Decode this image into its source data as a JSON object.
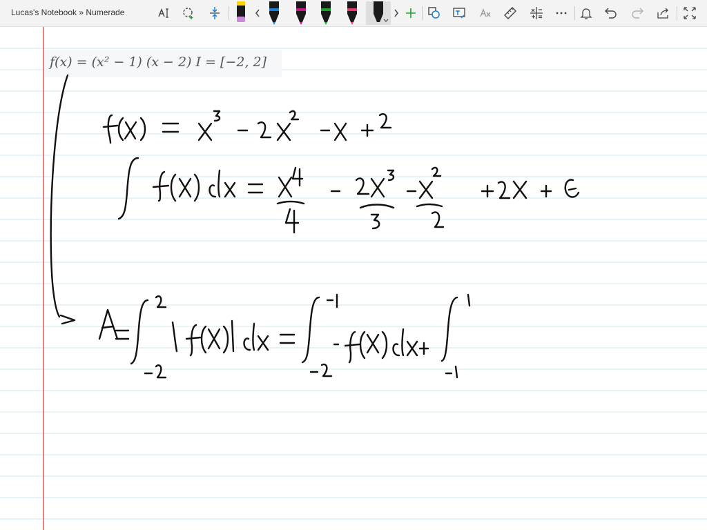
{
  "window": {
    "title": "Lucas's Notebook » Numerade"
  },
  "toolbar": {
    "icons": [
      "lasso-text-select-icon",
      "lasso-select-icon",
      "insert-space-icon",
      "eraser-icon",
      "chevron-left-icon",
      "pen-blue-icon",
      "pen-magenta-icon",
      "pen-green-icon",
      "pen-pink-icon",
      "pen-black-icon",
      "chevron-right-icon",
      "add-pen-icon",
      "ink-to-shape-icon",
      "ink-to-text-icon",
      "ink-to-math-icon",
      "ruler-icon",
      "math-icon",
      "more-icon",
      "notifications-icon",
      "undo-icon",
      "redo-icon",
      "share-icon",
      "fullscreen-icon"
    ],
    "pen_colors": {
      "blue": "#1e7fd8",
      "magenta": "#c2187f",
      "green": "#1aa52a",
      "pink": "#e43a6a",
      "black": "#1a1a1a"
    }
  },
  "page": {
    "margin_color": "#e23b3b",
    "rule_color": "#cfe6f3",
    "formula": "f(x) = (x² − 1) (x − 2)    I = [−2, 2]"
  }
}
